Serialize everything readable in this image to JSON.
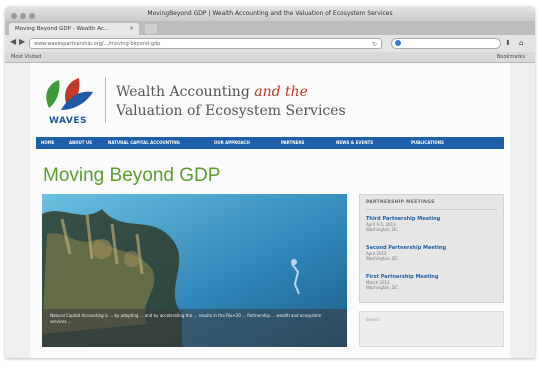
{
  "window": {
    "title": "MovingBeyond GDP | Wealth Accounting and the Valuation of Ecosystem Services"
  },
  "tab": {
    "label": "Moving Beyond GDP - Wealth Ac..."
  },
  "address": {
    "url": "www.wavespartnership.org/.../moving-beyond-gdp"
  },
  "bookmarks": {
    "left_label": "Most Visited",
    "right_label": "Bookmarks"
  },
  "site": {
    "logo_text": "WAVES",
    "headline_part1": "Wealth Accounting",
    "headline_emphasis": "and the",
    "headline_part2": "Valuation of Ecosystem Services",
    "brand_blue": "#1d5fa8",
    "accent_green": "#5e9e2f",
    "accent_red": "#c0392b"
  },
  "nav": {
    "items": [
      {
        "label": "HOME"
      },
      {
        "label": "ABOUT US"
      },
      {
        "label": "NATURAL CAPITAL ACCOUNTING"
      },
      {
        "label": "OUR APPROACH"
      },
      {
        "label": "PARTNERS"
      },
      {
        "label": "NEWS & EVENTS"
      },
      {
        "label": "PUBLICATIONS"
      }
    ]
  },
  "main": {
    "page_title": "Moving Beyond GDP",
    "hero_caption": "Natural Capital Accounting is ... by adopting ... and by accelerating the ... results in the Rio+20 ... Partnership ... wealth and ecosystem services ..."
  },
  "sidebar": {
    "title": "PARTNERSHIP MEETINGS",
    "meetings": [
      {
        "name": "Third Partnership Meeting",
        "date": "April 4-5, 2013",
        "place": "Washington, DC"
      },
      {
        "name": "Second Partnership Meeting",
        "date": "April 2012",
        "place": "Washington, DC"
      },
      {
        "name": "First Partnership Meeting",
        "date": "March 2011",
        "place": "Washington, DC"
      }
    ]
  },
  "sidebar2": {
    "label": "Search"
  }
}
